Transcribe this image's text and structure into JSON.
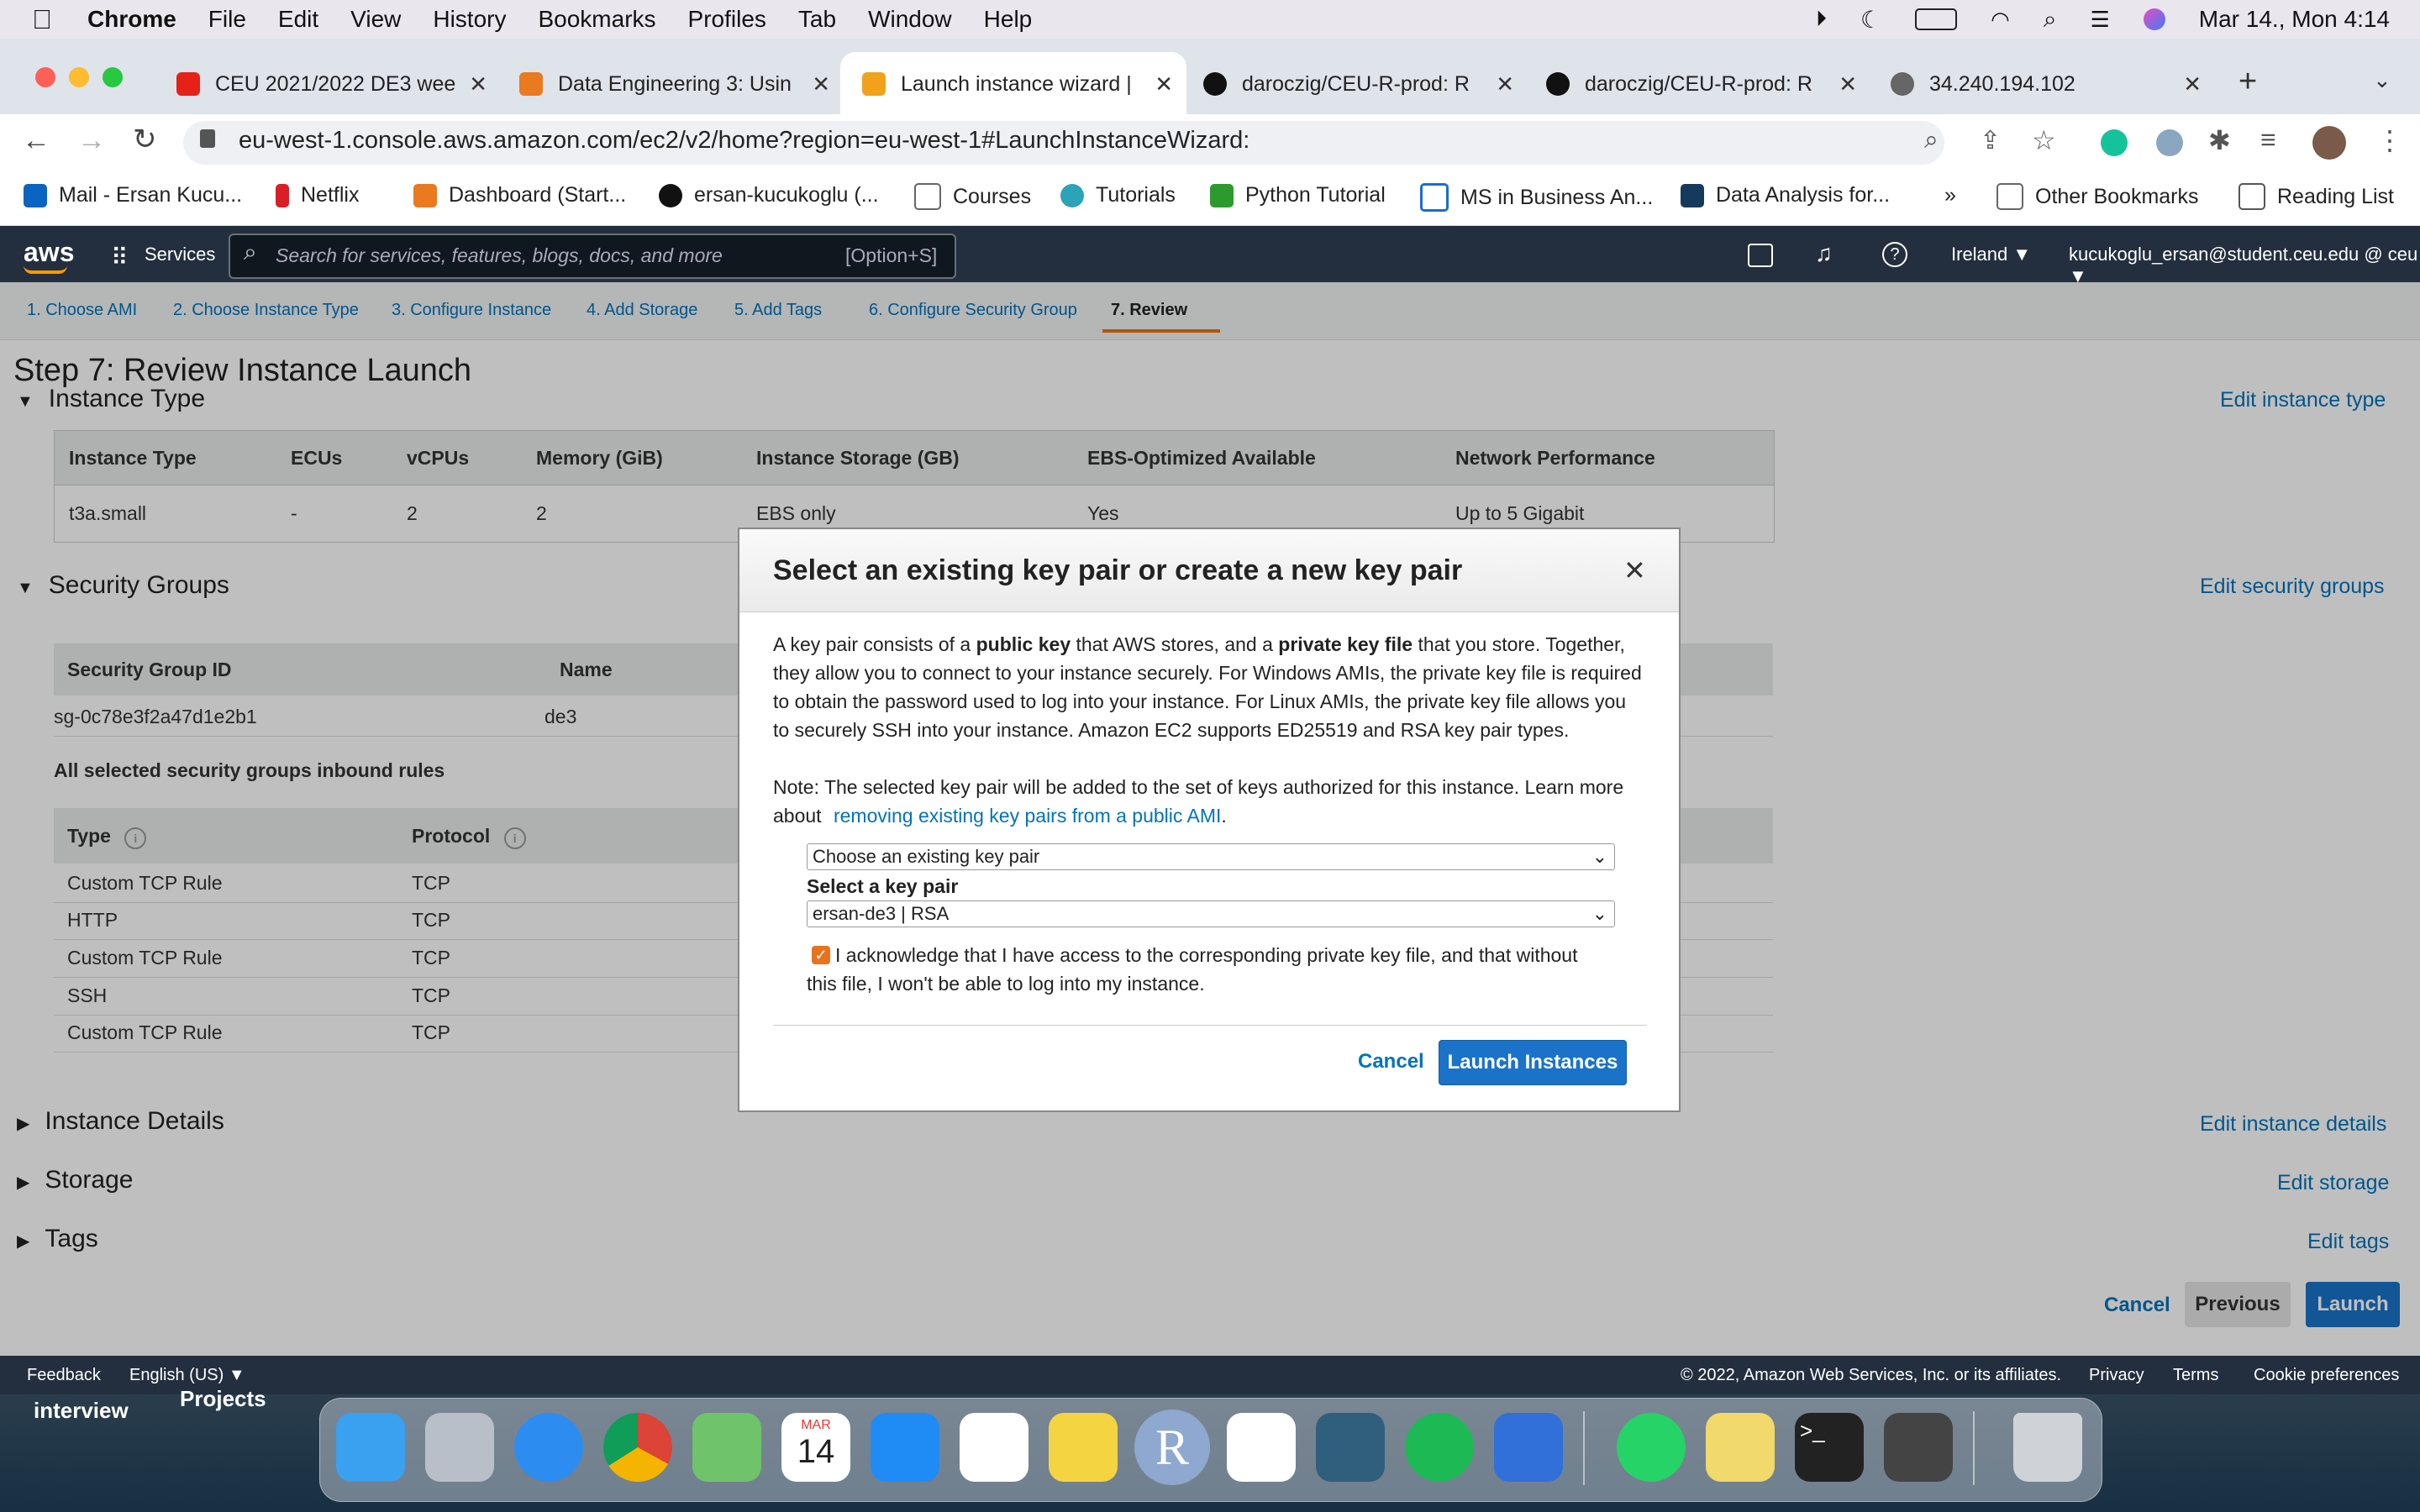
{
  "menubar": {
    "app": "Chrome",
    "items": [
      "File",
      "Edit",
      "View",
      "History",
      "Bookmarks",
      "Profiles",
      "Tab",
      "Window",
      "Help"
    ],
    "datetime": "Mar 14., Mon  4:14"
  },
  "tabs": [
    {
      "title": "CEU 2021/2022 DE3 wee",
      "color": "#e62117"
    },
    {
      "title": "Data Engineering 3: Usin",
      "color": "#e97a1f"
    },
    {
      "title": "Launch instance wizard |",
      "color": "#f0a21a"
    },
    {
      "title": "daroczig/CEU-R-prod: R",
      "color": "#111111"
    },
    {
      "title": "daroczig/CEU-R-prod: R",
      "color": "#111111"
    },
    {
      "title": "34.240.194.102",
      "color": "#666666"
    }
  ],
  "url": "eu-west-1.console.aws.amazon.com/ec2/v2/home?region=eu-west-1#LaunchInstanceWizard:",
  "bookmarks": [
    {
      "label": "Mail - Ersan Kucu...",
      "color": "#0a64c2"
    },
    {
      "label": "Netflix",
      "color": "#d81f26"
    },
    {
      "label": "Dashboard (Start...",
      "color": "#e97a1f"
    },
    {
      "label": "ersan-kucukoglu (...",
      "color": "#111111"
    },
    {
      "label": "Courses",
      "color": "#888888"
    },
    {
      "label": "Tutorials",
      "color": "#2ba3b8"
    },
    {
      "label": "Python Tutorial",
      "color": "#2c9a2c"
    },
    {
      "label": "MS in Business An...",
      "color": "#1a6ed1"
    },
    {
      "label": "Data Analysis for...",
      "color": "#163a5c"
    }
  ],
  "bookmarks_right": {
    "more": "»",
    "other": "Other Bookmarks",
    "reading": "Reading List"
  },
  "aws": {
    "logo": "aws",
    "services": "Services",
    "search_placeholder": "Search for services, features, blogs, docs, and more",
    "search_shortcut": "[Option+S]",
    "region": "Ireland ▼",
    "account": "kucukoglu_ersan@student.ceu.edu @ ceu ▼"
  },
  "steps": [
    "1. Choose AMI",
    "2. Choose Instance Type",
    "3. Configure Instance",
    "4. Add Storage",
    "5. Add Tags",
    "6. Configure Security Group",
    "7. Review"
  ],
  "page_title": "Step 7: Review Instance Launch",
  "instance_type": {
    "heading": "Instance Type",
    "edit": "Edit instance type",
    "headers": [
      "Instance Type",
      "ECUs",
      "vCPUs",
      "Memory (GiB)",
      "Instance Storage (GB)",
      "EBS-Optimized Available",
      "Network Performance"
    ],
    "row": [
      "t3a.small",
      "-",
      "2",
      "2",
      "EBS only",
      "Yes",
      "Up to 5 Gigabit"
    ]
  },
  "security_groups": {
    "heading": "Security Groups",
    "edit": "Edit security groups",
    "headers": [
      "Security Group ID",
      "Name"
    ],
    "row": [
      "sg-0c78e3f2a47d1e2b1",
      "de3"
    ],
    "inbound_title": "All selected security groups inbound rules",
    "rule_headers": [
      "Type",
      "Protocol"
    ],
    "rules": [
      [
        "Custom TCP Rule",
        "TCP"
      ],
      [
        "HTTP",
        "TCP"
      ],
      [
        "Custom TCP Rule",
        "TCP"
      ],
      [
        "SSH",
        "TCP"
      ],
      [
        "Custom TCP Rule",
        "TCP"
      ]
    ]
  },
  "collapsed": [
    {
      "title": "Instance Details",
      "edit": "Edit instance details"
    },
    {
      "title": "Storage",
      "edit": "Edit storage"
    },
    {
      "title": "Tags",
      "edit": "Edit tags"
    }
  ],
  "page_buttons": {
    "cancel": "Cancel",
    "previous": "Previous",
    "launch": "Launch"
  },
  "footer": {
    "feedback": "Feedback",
    "language": "English (US) ▼",
    "copyright": "© 2022, Amazon Web Services, Inc. or its affiliates.",
    "privacy": "Privacy",
    "terms": "Terms",
    "cookies": "Cookie preferences"
  },
  "modal": {
    "title": "Select an existing key pair or create a new key pair",
    "close": "✕",
    "p1_a": "A key pair consists of a ",
    "p1_b": "public key",
    "p1_c": " that AWS stores, and a ",
    "p1_d": "private key file",
    "p1_e": " that you store. Together, they allow you to connect to your instance securely. For Windows AMIs, the private key file is required to obtain the password used to log into your instance. For Linux AMIs, the private key file allows you to securely SSH into your instance. Amazon EC2 supports ED25519 and RSA key pair types.",
    "note_a": "Note: The selected key pair will be added to the set of keys authorized for this instance. Learn more about ",
    "note_link": "removing existing key pairs from a public AMI",
    "note_end": ".",
    "select_mode": "Choose an existing key pair",
    "select_label": "Select a key pair",
    "key_value": "ersan-de3 | RSA",
    "ack": "I acknowledge that I have access to the corresponding private key file, and that without this file, I won't be able to log into my instance.",
    "ack_checked": true,
    "cancel": "Cancel",
    "launch": "Launch Instances"
  },
  "desktop": {
    "label1": "interview",
    "label2": "Projects"
  },
  "dock": [
    {
      "name": "finder",
      "color": "#3aa0f0"
    },
    {
      "name": "launchpad",
      "color": "#b9bfc8"
    },
    {
      "name": "safari",
      "color": "#2d8cf0"
    },
    {
      "name": "chrome",
      "color": "#f1f1f1"
    },
    {
      "name": "maps",
      "color": "#6fc36b"
    },
    {
      "name": "calendar",
      "color": "#ffffff"
    },
    {
      "name": "app-store",
      "color": "#1f8cf5"
    },
    {
      "name": "reminders",
      "color": "#ffffff"
    },
    {
      "name": "notes",
      "color": "#f5d442"
    },
    {
      "name": "r",
      "color": "#8fa8cf"
    },
    {
      "name": "slack",
      "color": "#ffffff"
    },
    {
      "name": "mysql-workbench",
      "color": "#2f5f7d"
    },
    {
      "name": "spotify",
      "color": "#1db954"
    },
    {
      "name": "files",
      "color": "#3070d8"
    },
    {
      "name": "whatsapp",
      "color": "#25d366"
    },
    {
      "name": "stickies",
      "color": "#f1d96b"
    },
    {
      "name": "terminal",
      "color": "#222222"
    },
    {
      "name": "xquartz",
      "color": "#444444"
    },
    {
      "name": "trash",
      "color": "#cfd3d8"
    }
  ],
  "calendar_icon": {
    "month": "MAR",
    "day": "14"
  },
  "r_icon": "R"
}
